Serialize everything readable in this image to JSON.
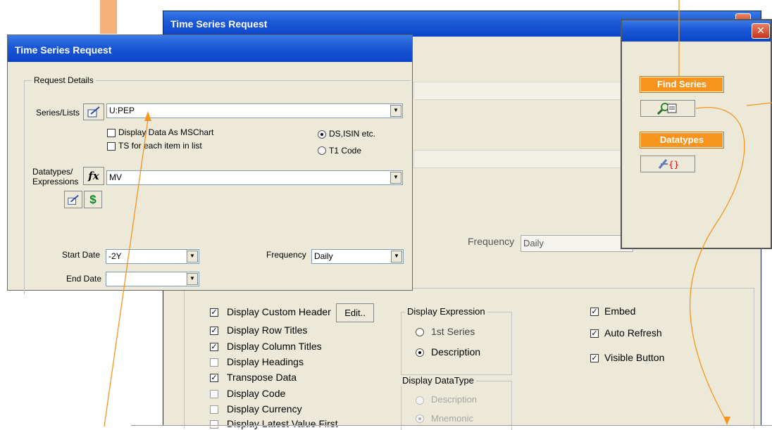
{
  "back_window": {
    "title": "Time Series Request",
    "frequency_label": "Frequency",
    "frequency_value": "Daily",
    "options": [
      {
        "label": "Display Custom Header",
        "checked": true
      },
      {
        "label": "Display Row Titles",
        "checked": true
      },
      {
        "label": "Display Column Titles",
        "checked": true
      },
      {
        "label": "Display Headings",
        "checked": false
      },
      {
        "label": "Transpose Data",
        "checked": true
      },
      {
        "label": "Display Code",
        "checked": false
      },
      {
        "label": "Display Currency",
        "checked": false
      },
      {
        "label": "Display Latest Value First",
        "checked": false
      }
    ],
    "edit_button": "Edit..",
    "display_expression": {
      "legend": "Display Expression",
      "options": [
        {
          "label": "1st Series",
          "selected": false
        },
        {
          "label": "Description",
          "selected": true
        }
      ]
    },
    "display_datatype": {
      "legend": "Display DataType",
      "options": [
        {
          "label": "Description",
          "selected": false
        },
        {
          "label": "Mnemonic",
          "selected": true
        }
      ]
    },
    "right_options": [
      {
        "label": "Embed",
        "checked": true
      },
      {
        "label": "Auto Refresh",
        "checked": true
      },
      {
        "label": "Visible Button",
        "checked": true
      }
    ]
  },
  "front_window": {
    "title": "Time Series Request",
    "group_label": "Request Details",
    "series_label": "Series/Lists",
    "series_value": "U:PEP",
    "check_mschart": "Display Data As MSChart",
    "check_ts_each": "TS for each item in list",
    "radio_ds": "DS,ISIN etc.",
    "radio_t1": "T1 Code",
    "datatypes_label_1": "Datatypes/",
    "datatypes_label_2": "Expressions",
    "datatypes_value": "MV",
    "fx_icon": "fx",
    "dollar_icon": "$",
    "start_date_label": "Start Date",
    "start_date_value": "-2Y",
    "end_date_label": "End Date",
    "end_date_value": "",
    "frequency_label": "Frequency",
    "frequency_value": "Daily"
  },
  "callout_window": {
    "close_glyph": "✕",
    "find_series_label": "Find Series",
    "datatypes_label": "Datatypes"
  },
  "colors": {
    "annotation": "#f7941d",
    "titlebar": "#0a45c9"
  }
}
